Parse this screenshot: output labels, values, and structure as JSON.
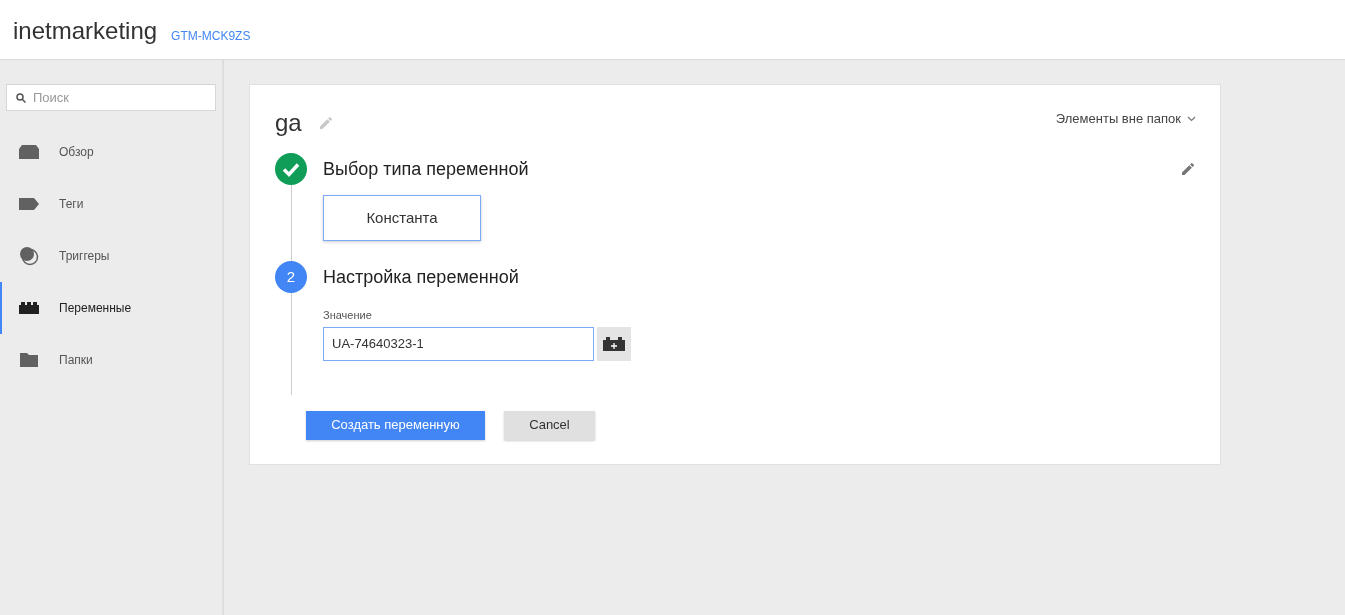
{
  "header": {
    "title": "inetmarketing",
    "container_id": "GTM-MCK9ZS"
  },
  "sidebar": {
    "search": {
      "placeholder": "Поиск"
    },
    "items": [
      {
        "label": "Обзор",
        "kind": "overview",
        "selected": false
      },
      {
        "label": "Теги",
        "kind": "tag",
        "selected": false
      },
      {
        "label": "Триггеры",
        "kind": "trigger",
        "selected": false
      },
      {
        "label": "Переменные",
        "kind": "variable",
        "selected": true
      },
      {
        "label": "Папки",
        "kind": "folder",
        "selected": false
      }
    ]
  },
  "editor": {
    "name": "ga",
    "folder": "Элементы вне папок",
    "steps": [
      {
        "kind": "done",
        "title": "Выбор типа переменной",
        "type_label": "Константа"
      },
      {
        "kind": "active",
        "number": "2",
        "title": "Настройка переменной",
        "field_label": "Значение",
        "value": "UA-74640323-1"
      }
    ],
    "buttons": [
      {
        "label": "Создать переменную",
        "primary": true
      },
      {
        "label": "Cancel",
        "primary": false
      }
    ]
  }
}
